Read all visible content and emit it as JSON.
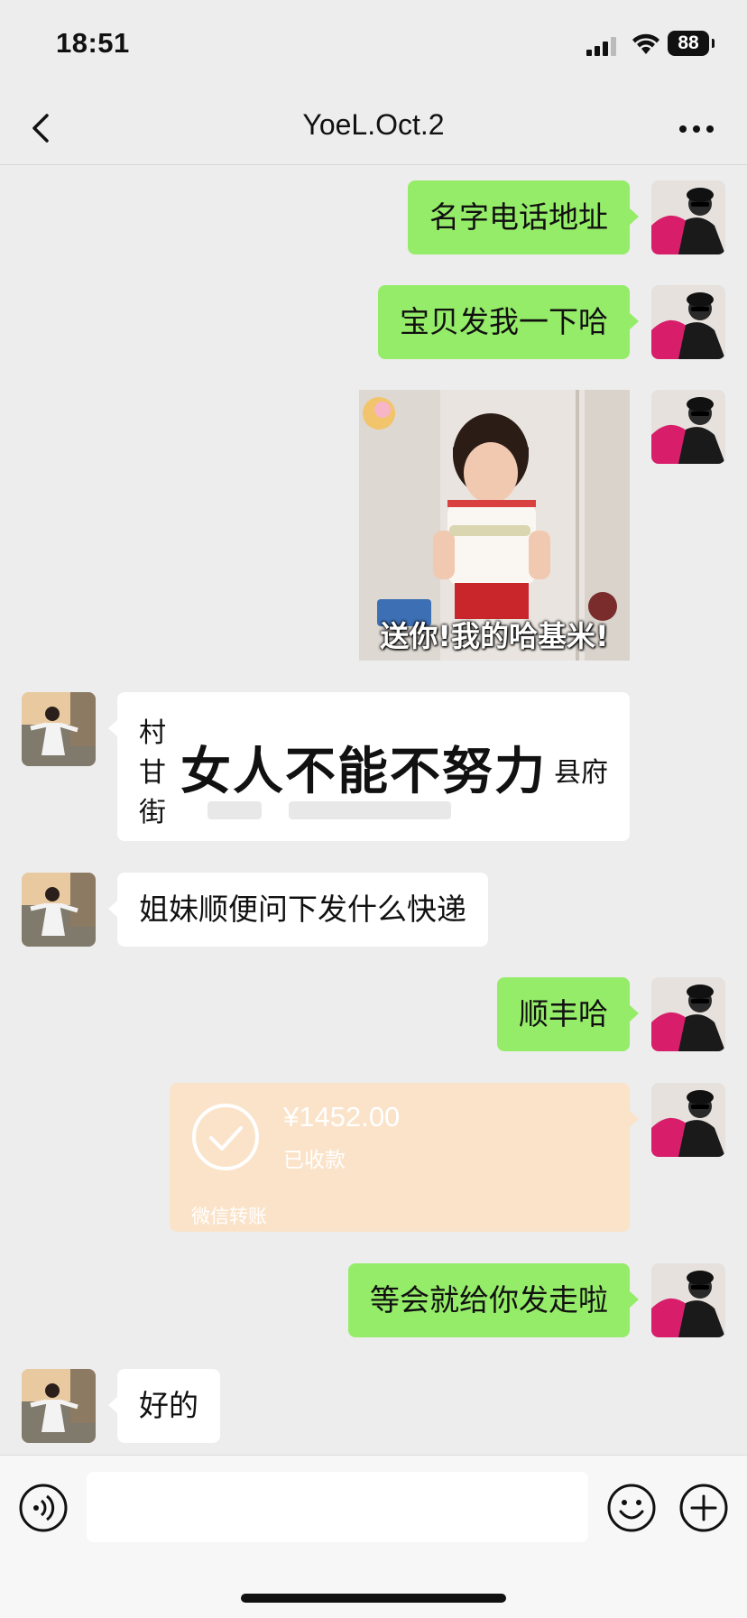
{
  "status_bar": {
    "time": "18:51",
    "battery": "88"
  },
  "header": {
    "title": "YoeL.Oct.2"
  },
  "messages": {
    "m1": "名字电话地址",
    "m2": "宝贝发我一下哈",
    "sticker_caption": "送你!我的哈基米!",
    "address_left_1": "村",
    "address_left_2": "甘",
    "address_left_3": "街",
    "address_right": "县府",
    "address_overlay": "女人不能不努力",
    "m4": "姐妹顺便问下发什么快递",
    "m5": "顺丰哈",
    "transfer_amount": "¥1452.00",
    "transfer_status": "已收款",
    "transfer_footer": "微信转账",
    "m6": "等会就给你发走啦",
    "m7": "好的"
  },
  "icons": {
    "back": "chevron-left-icon",
    "more": "more-dots-icon",
    "voice": "voice-icon",
    "emoji": "emoji-icon",
    "plus": "plus-icon"
  },
  "colors": {
    "my_bubble": "#95ec69",
    "their_bubble": "#ffffff",
    "transfer": "#fbe3c9",
    "background": "#ededed"
  }
}
